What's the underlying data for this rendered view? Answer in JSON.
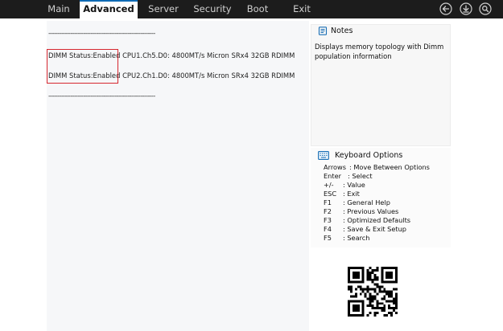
{
  "tabs": [
    {
      "label": "Main",
      "active": false
    },
    {
      "label": "Advanced",
      "active": true
    },
    {
      "label": "Server",
      "active": false
    },
    {
      "label": "Security",
      "active": false
    },
    {
      "label": "Boot",
      "active": false
    },
    {
      "label": "Exit",
      "active": false
    }
  ],
  "top_icons": [
    "back-arrow-icon",
    "download-icon",
    "search-icon"
  ],
  "content": {
    "divider": "----------------------------------------------------------",
    "dimm_rows": [
      {
        "status": "DIMM Status:Enabled",
        "info": "CPU1.Ch5.D0: 4800MT/s Micron SRx4 32GB RDIMM"
      },
      {
        "status": "DIMM Status:Enabled",
        "info": "CPU2.Ch1.D0: 4800MT/s Micron SRx4 32GB RDIMM"
      }
    ]
  },
  "notes": {
    "title": "Notes",
    "text": "Displays memory topology with Dimm population information"
  },
  "keyboard": {
    "title": "Keyboard Options",
    "items": [
      {
        "key": "Arrows",
        "desc": ": Move Between Options"
      },
      {
        "key": "Enter",
        "desc": ": Select"
      },
      {
        "key": "+/-",
        "desc": ": Value"
      },
      {
        "key": "ESC",
        "desc": ": Exit"
      },
      {
        "key": "F1",
        "desc": ": General Help"
      },
      {
        "key": "F2",
        "desc": ": Previous Values"
      },
      {
        "key": "F3",
        "desc": ": Optimized Defaults"
      },
      {
        "key": "F4",
        "desc": ": Save & Exit Setup"
      },
      {
        "key": "F5",
        "desc": ": Search"
      }
    ]
  },
  "colors": {
    "accent": "#0e6bb5",
    "highlight": "#d6272f",
    "topbar": "#1c1c1c"
  }
}
